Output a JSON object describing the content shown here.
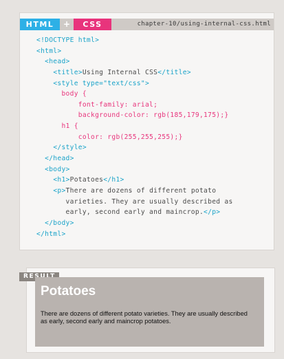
{
  "tabs": {
    "html": "HTML",
    "plus": "+",
    "css": "CSS"
  },
  "file_path": "chapter-10/using-internal-css.html",
  "code_lines": [
    [
      {
        "c": "t",
        "s": "<!DOCTYPE html>"
      }
    ],
    [
      {
        "c": "t",
        "s": "<html>"
      }
    ],
    [
      {
        "c": "x",
        "s": "  "
      },
      {
        "c": "t",
        "s": "<head>"
      }
    ],
    [
      {
        "c": "x",
        "s": "    "
      },
      {
        "c": "t",
        "s": "<title>"
      },
      {
        "c": "x",
        "s": "Using Internal CSS"
      },
      {
        "c": "t",
        "s": "</title>"
      }
    ],
    [
      {
        "c": "x",
        "s": "    "
      },
      {
        "c": "t",
        "s": "<style type=\"text/css\">"
      }
    ],
    [
      {
        "c": "x",
        "s": "      "
      },
      {
        "c": "k",
        "s": "body {"
      }
    ],
    [
      {
        "c": "x",
        "s": "          "
      },
      {
        "c": "k",
        "s": "font-family: arial;"
      }
    ],
    [
      {
        "c": "x",
        "s": "          "
      },
      {
        "c": "k",
        "s": "background-color: rgb(185,179,175);}"
      }
    ],
    [
      {
        "c": "x",
        "s": "      "
      },
      {
        "c": "k",
        "s": "h1 {"
      }
    ],
    [
      {
        "c": "x",
        "s": "          "
      },
      {
        "c": "k",
        "s": "color: rgb(255,255,255);}"
      }
    ],
    [
      {
        "c": "x",
        "s": "    "
      },
      {
        "c": "t",
        "s": "</style>"
      }
    ],
    [
      {
        "c": "x",
        "s": "  "
      },
      {
        "c": "t",
        "s": "</head>"
      }
    ],
    [
      {
        "c": "x",
        "s": "  "
      },
      {
        "c": "t",
        "s": "<body>"
      }
    ],
    [
      {
        "c": "x",
        "s": "    "
      },
      {
        "c": "t",
        "s": "<h1>"
      },
      {
        "c": "x",
        "s": "Potatoes"
      },
      {
        "c": "t",
        "s": "</h1>"
      }
    ],
    [
      {
        "c": "x",
        "s": "    "
      },
      {
        "c": "t",
        "s": "<p>"
      },
      {
        "c": "x",
        "s": "There are dozens of different potato"
      }
    ],
    [
      {
        "c": "x",
        "s": "       varieties. They are usually described as"
      }
    ],
    [
      {
        "c": "x",
        "s": "       early, second early and maincrop."
      },
      {
        "c": "t",
        "s": "</p>"
      }
    ],
    [
      {
        "c": "x",
        "s": "  "
      },
      {
        "c": "t",
        "s": "</body>"
      }
    ],
    [
      {
        "c": "t",
        "s": "</html>"
      }
    ]
  ],
  "result": {
    "label": "RESULT",
    "heading": "Potatoes",
    "paragraph": "There are dozens of different potato varieties. They are usually described as early, second early and maincrop potatoes."
  },
  "colors": {
    "tag": "#1aa3c9",
    "css": "#e8347c",
    "html_tab": "#2db0e6",
    "css_tab": "#e8347c",
    "result_bg": "#b9b3af"
  }
}
